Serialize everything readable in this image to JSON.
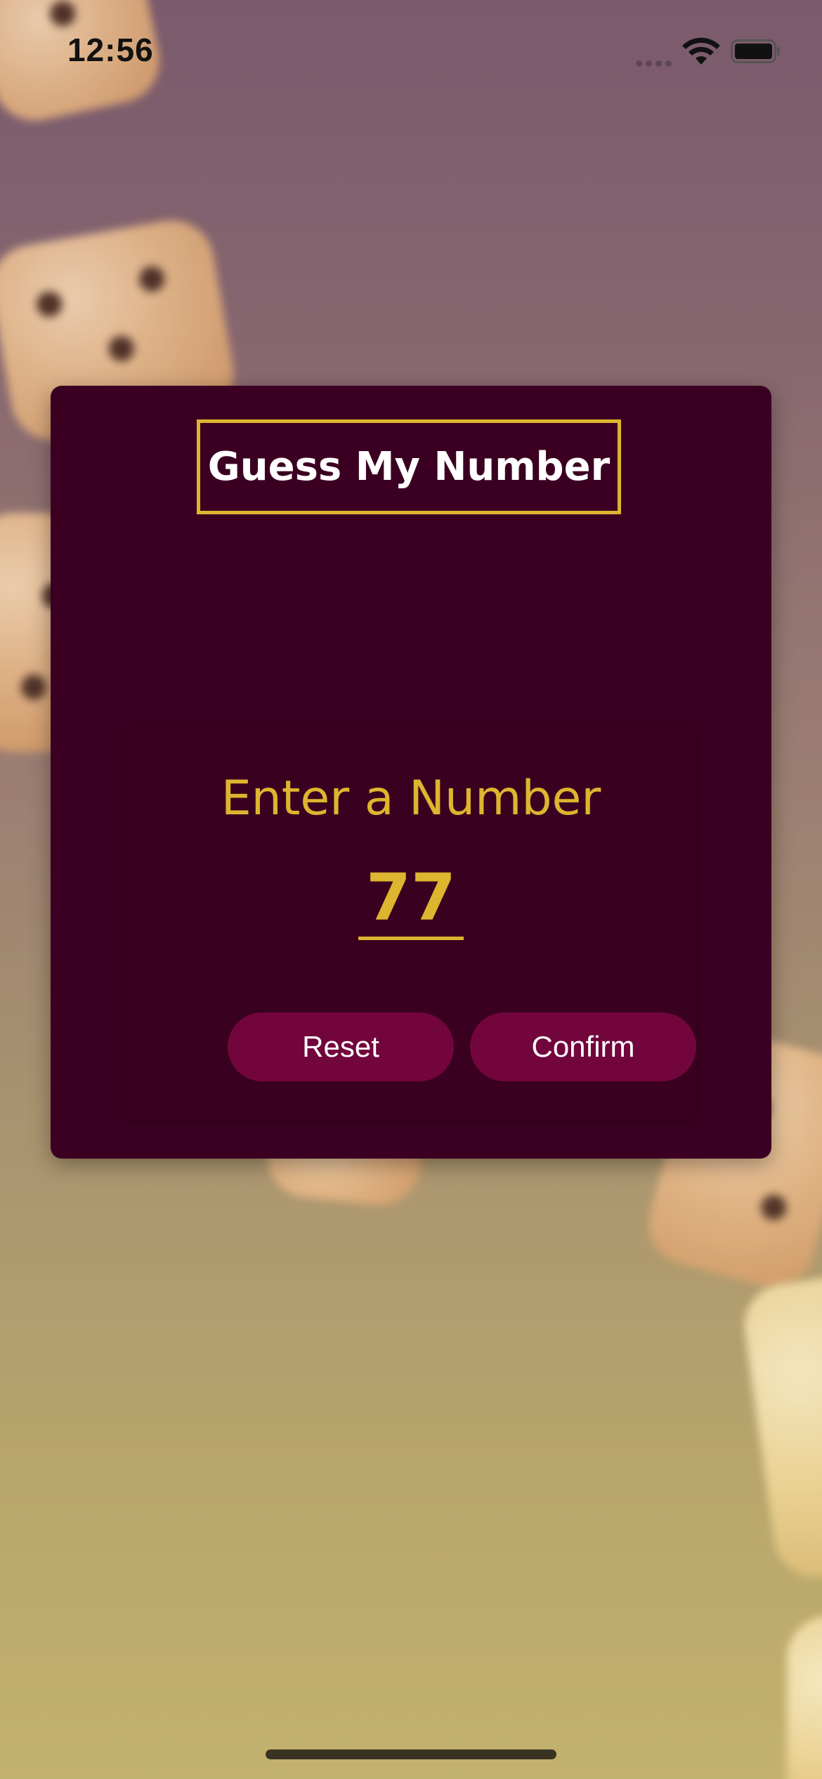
{
  "status_bar": {
    "time": "12:56",
    "icons": [
      "cellular-signal-icon",
      "wifi-icon",
      "battery-icon"
    ]
  },
  "header": {
    "title": "Guess My Number"
  },
  "input_panel": {
    "instruction": "Enter a Number",
    "number_value": "77",
    "reset_label": "Reset",
    "confirm_label": "Confirm"
  },
  "colors": {
    "accent": "#ddb52f",
    "card_background": "#3b0021",
    "button_background": "#72063c",
    "title_text": "#ffffff"
  }
}
